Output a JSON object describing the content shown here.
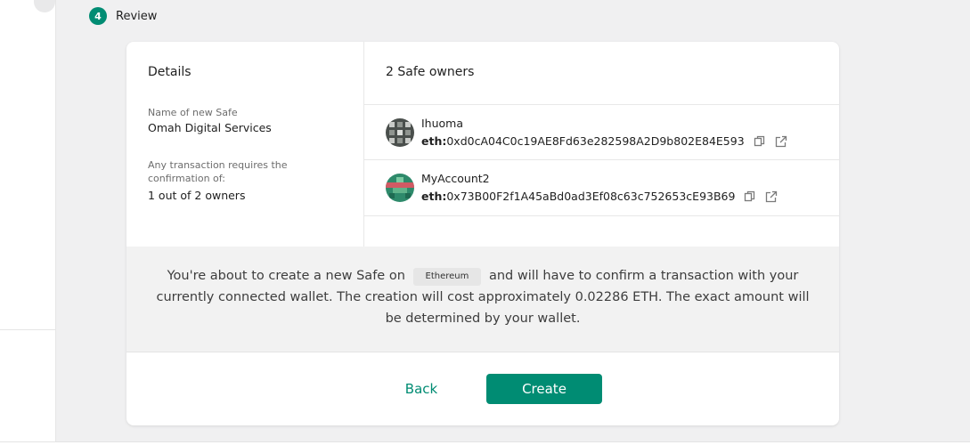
{
  "step": {
    "number": "4",
    "label": "Review"
  },
  "details": {
    "title": "Details",
    "name_label": "Name of new Safe",
    "name_value": "Omah Digital Services",
    "threshold_label": "Any transaction requires the confirmation of:",
    "threshold_value": "1 out of 2 owners"
  },
  "owners": {
    "title": "2 Safe owners",
    "items": [
      {
        "name": "Ihuoma",
        "prefix": "eth:",
        "address": "0xd0cA04C0c19AE8Fd63e282598A2D9b802E84E593",
        "avatar_icon": "identicon-avatar-icon"
      },
      {
        "name": "MyAccount2",
        "prefix": "eth:",
        "address": "0x73B00F2f1A45aBd0ad3Ef08c63c752653cE93B69",
        "avatar_icon": "identicon-avatar-icon"
      }
    ]
  },
  "notice": {
    "before": "You're about to create a new Safe on",
    "network": "Ethereum",
    "after": "and will have to confirm a transaction with your currently connected wallet. The creation will cost approximately 0.02286 ETH. The exact amount will be determined by your wallet."
  },
  "actions": {
    "back_label": "Back",
    "create_label": "Create"
  },
  "colors": {
    "accent": "#008c73",
    "notice_bg": "#f2f2f2"
  }
}
